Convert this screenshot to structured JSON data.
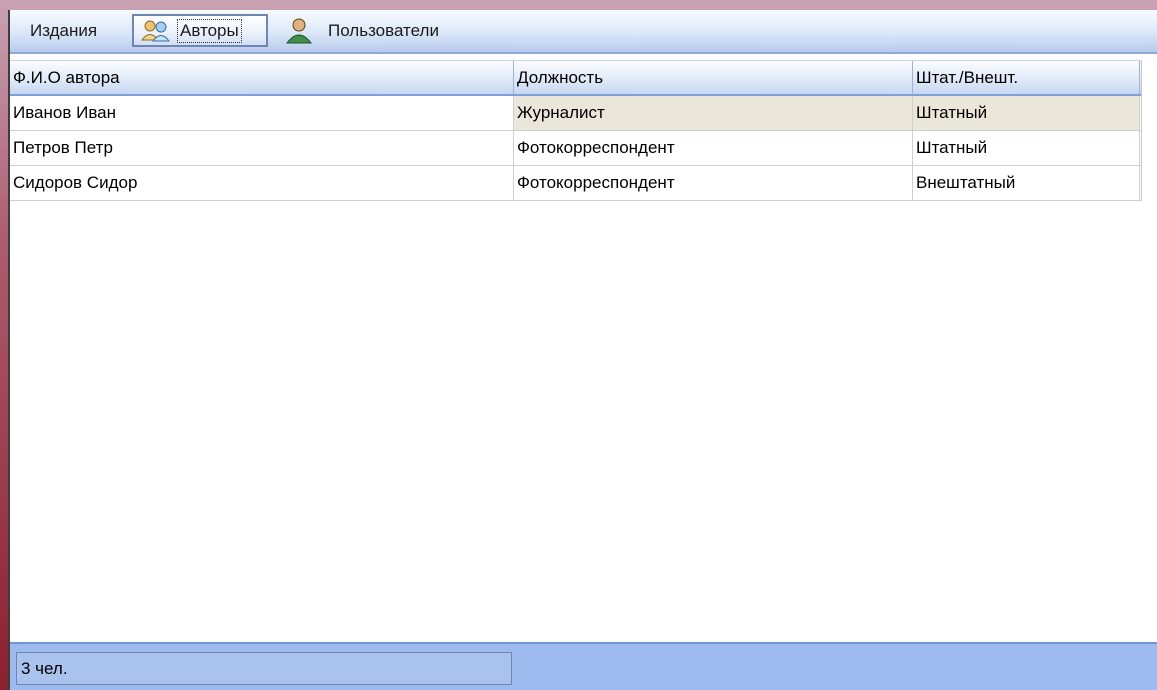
{
  "tabs": {
    "izdaniya": "Издания",
    "avtory": "Авторы",
    "polzovateli": "Пользователи"
  },
  "table": {
    "columns": [
      "Ф.И.О автора",
      "Должность",
      "Штат./Внешт."
    ],
    "rows": [
      [
        "Иванов Иван",
        "Журналист",
        "Штатный"
      ],
      [
        "Петров Петр",
        "Фотокорреспондент",
        "Штатный"
      ],
      [
        "Сидоров Сидор",
        "Фотокорреспондент",
        "Внештатный"
      ]
    ]
  },
  "status": {
    "count": "3 чел."
  },
  "colors": {
    "accent": "#9ebbef",
    "selected_row": "#ebe6da"
  }
}
